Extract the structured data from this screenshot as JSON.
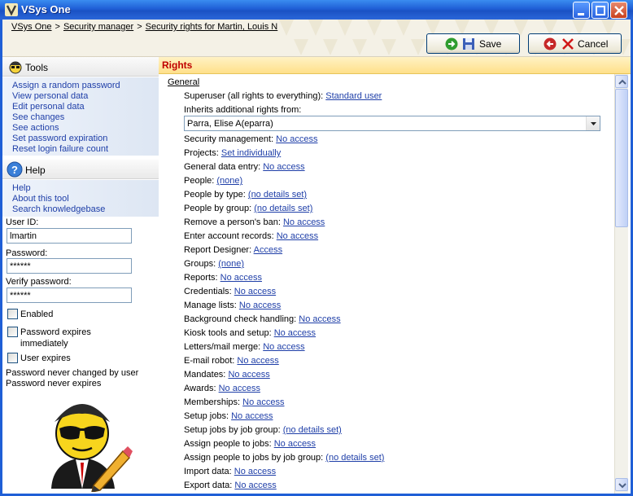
{
  "window": {
    "title": "VSys One"
  },
  "breadcrumb": [
    "VSys One",
    "Security manager",
    "Security rights for Martin, Louis N"
  ],
  "toolbar": {
    "save_label": "Save",
    "cancel_label": "Cancel"
  },
  "tools": {
    "title": "Tools",
    "items": [
      "Assign a random password",
      "View personal data",
      "Edit personal data",
      "See changes",
      "See actions",
      "Set password expiration",
      "Reset login failure count"
    ]
  },
  "help": {
    "title": "Help",
    "items": [
      "Help",
      "About this tool",
      "Search knowledgebase"
    ]
  },
  "form": {
    "user_id_label": "User ID:",
    "user_id_value": "lmartin",
    "password_label": "Password:",
    "password_value": "******",
    "verify_label": "Verify password:",
    "verify_value": "******",
    "enabled_label": "Enabled",
    "pw_expires_label": "Password expires immediately",
    "user_expires_label": "User expires",
    "status_1": "Password never changed by user",
    "status_2": "Password never expires"
  },
  "rights": {
    "header": "Rights",
    "section": "General",
    "superuser_label": "Superuser (all rights to everything):",
    "superuser_value": "Standard user",
    "inherits_label": "Inherits additional rights from:",
    "inherits_value": "Parra, Elise A(eparra)",
    "items": [
      {
        "label": "Security management:",
        "value": "No access"
      },
      {
        "label": "Projects:",
        "value": "Set individually"
      },
      {
        "label": "General data entry:",
        "value": "No access"
      },
      {
        "label": "People:",
        "value": "(none)"
      },
      {
        "label": "People by type:",
        "value": "(no details set)"
      },
      {
        "label": "People by group:",
        "value": "(no details set)"
      },
      {
        "label": "Remove a person's ban:",
        "value": "No access"
      },
      {
        "label": "Enter account records:",
        "value": "No access"
      },
      {
        "label": "Report Designer:",
        "value": "Access"
      },
      {
        "label": "Groups:",
        "value": "(none)"
      },
      {
        "label": "Reports:",
        "value": "No access"
      },
      {
        "label": "Credentials:",
        "value": "No access"
      },
      {
        "label": "Manage lists:",
        "value": "No access"
      },
      {
        "label": "Background check handling:",
        "value": "No access"
      },
      {
        "label": "Kiosk tools and setup:",
        "value": "No access"
      },
      {
        "label": "Letters/mail merge:",
        "value": "No access"
      },
      {
        "label": "E-mail robot:",
        "value": "No access"
      },
      {
        "label": "Mandates:",
        "value": "No access"
      },
      {
        "label": "Awards:",
        "value": "No access"
      },
      {
        "label": "Memberships:",
        "value": "No access"
      },
      {
        "label": "Setup jobs:",
        "value": "No access"
      },
      {
        "label": "Setup jobs by job group:",
        "value": "(no details set)"
      },
      {
        "label": "Assign people to jobs:",
        "value": "No access"
      },
      {
        "label": "Assign people to jobs by job group:",
        "value": "(no details set)"
      },
      {
        "label": "Import data:",
        "value": "No access"
      },
      {
        "label": "Export data:",
        "value": "No access"
      }
    ]
  },
  "icons": {
    "app": "app-logo-icon",
    "tools": "agent-face-icon",
    "help": "question-circle-icon",
    "save": "floppy-disk-icon",
    "cancel": "x-icon",
    "mascot": "security-agent-pencil-icon"
  }
}
